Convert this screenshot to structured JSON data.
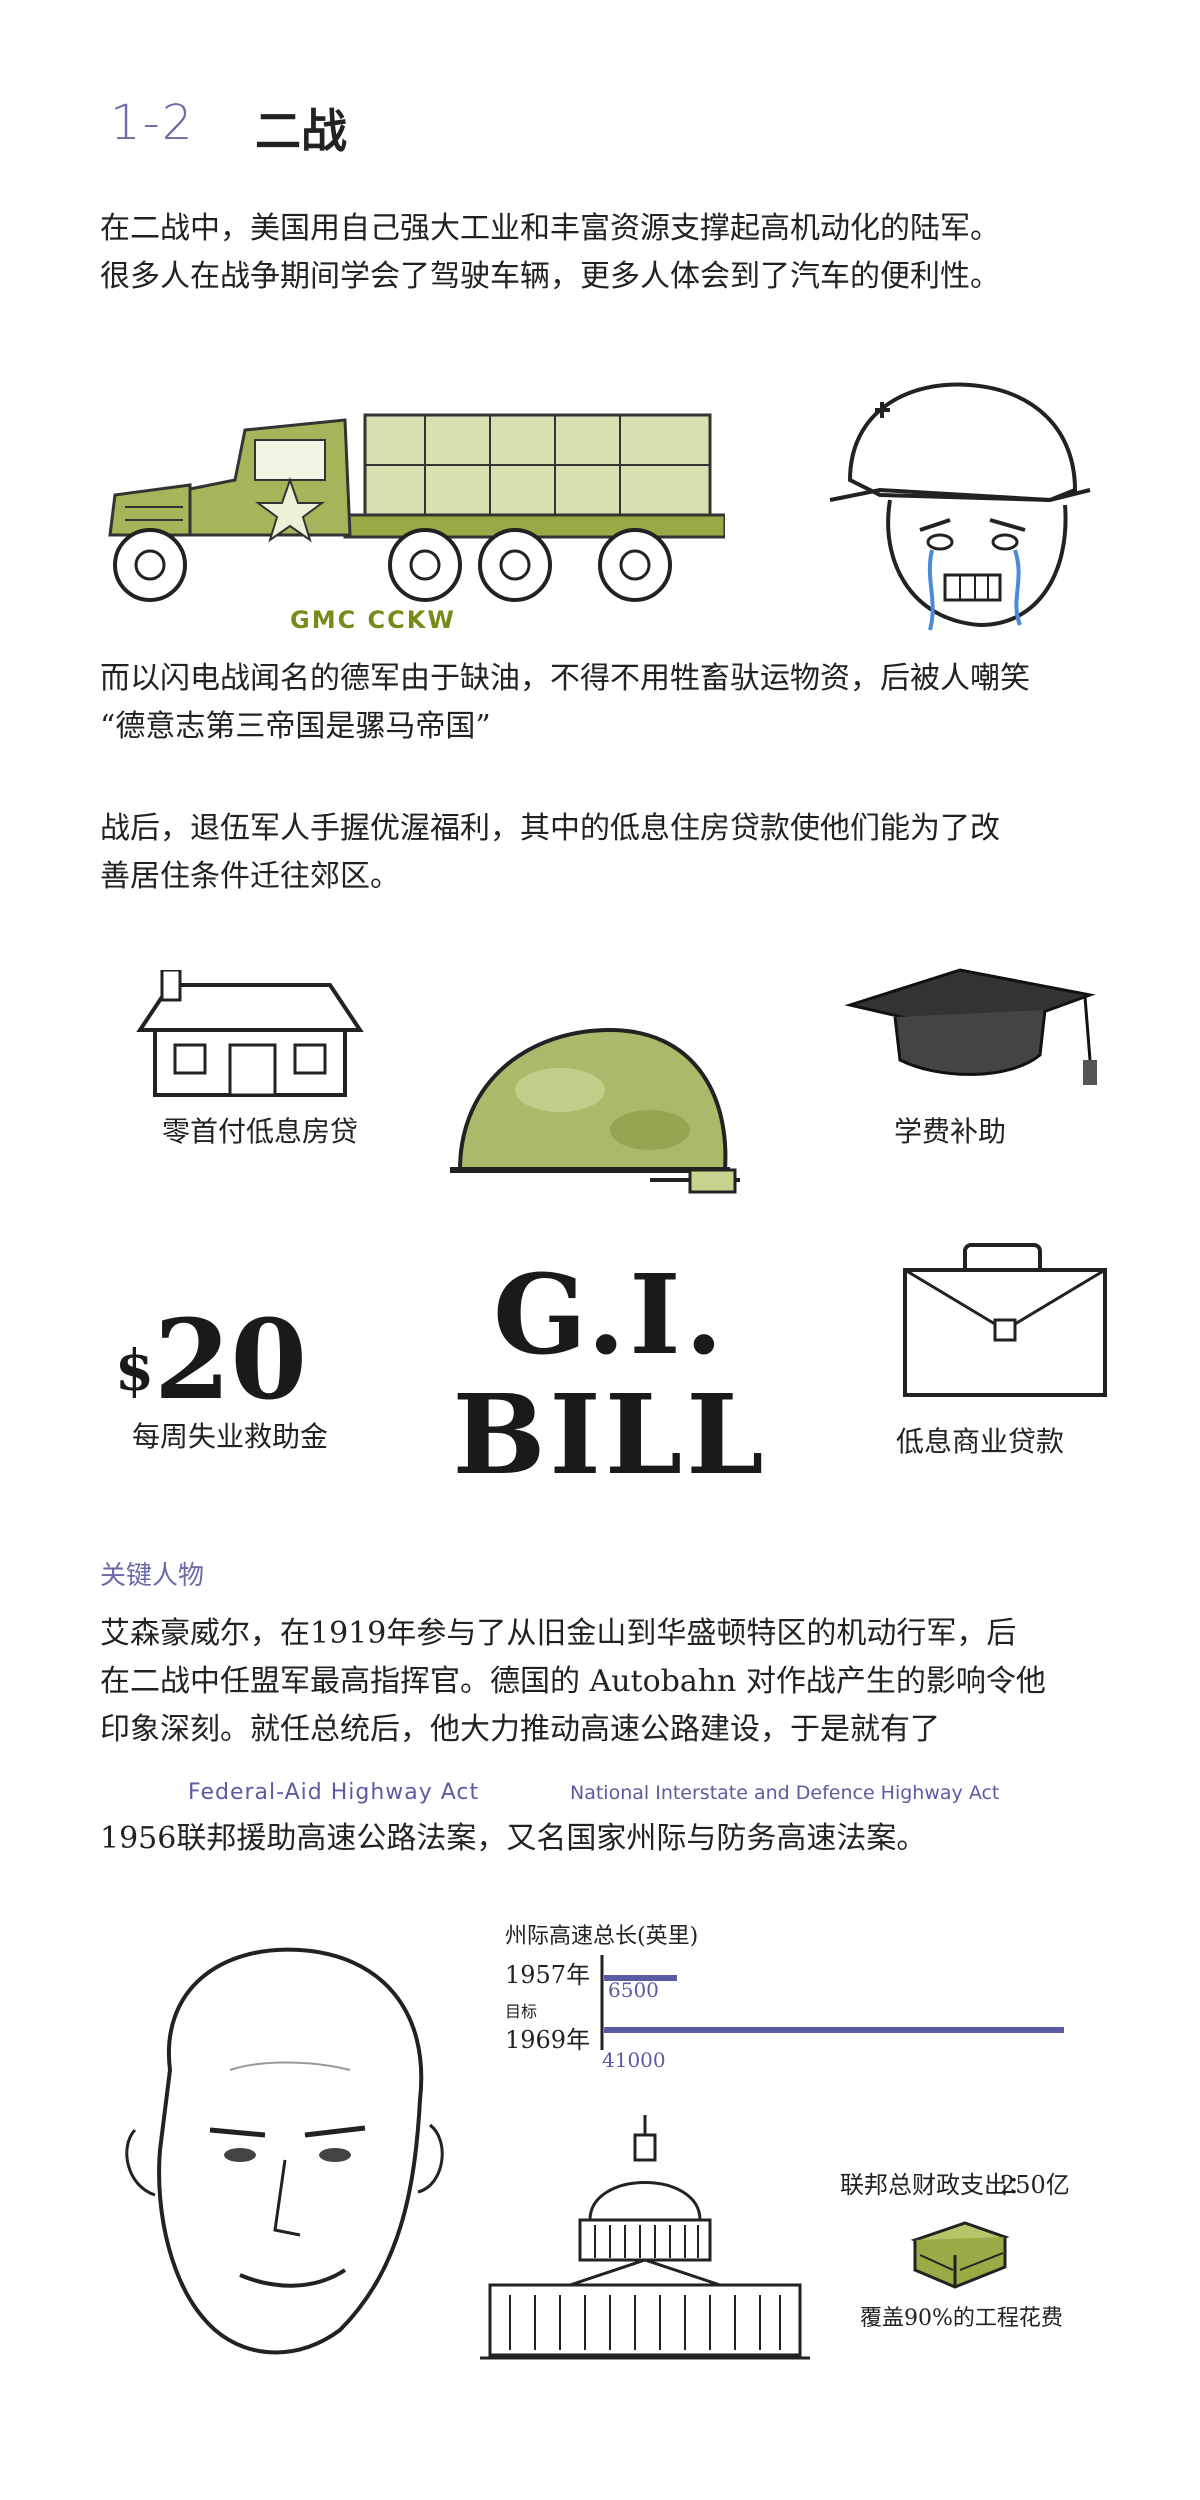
{
  "section": {
    "number": "1-2",
    "title": "二战"
  },
  "intro": {
    "line1": "在二战中，美国用自己强大工业和丰富资源支撑起高机动化的陆军。",
    "line2": "很多人在战争期间学会了驾驶车辆，更多人体会到了汽车的便利性。"
  },
  "truck_caption": "GMC CCKW",
  "blitz": {
    "line1": "而以闪电战闻名的德军由于缺油，不得不用牲畜驮运物资，后被人嘲笑",
    "line2": "“德意志第三帝国是骡马帝国”"
  },
  "postwar": {
    "line1": "战后，退伍军人手握优渥福利，其中的低息住房贷款使他们能为了改",
    "line2": "善居住条件迁往郊区。"
  },
  "benefits": {
    "house": "零首付低息房贷",
    "tuition": "学费补助",
    "unemployment": "每周失业救助金",
    "business_loan": "低息商业贷款",
    "dollar_sign": "$",
    "dollar_amount": "20",
    "gi_line1": "G.I.",
    "gi_line2": "BILL"
  },
  "key_figure_label": "关键人物",
  "ike": {
    "line1": "艾森豪威尔，在1919年参与了从旧金山到华盛顿特区的机动行军，后",
    "line2": "在二战中任盟军最高指挥官。德国的 Autobahn 对作战产生的影响令他",
    "line3": "印象深刻。就任总统后，他大力推动高速公路建设，于是就有了"
  },
  "act": {
    "en1": "Federal-Aid Highway Act",
    "en2": "National Interstate and Defence Highway Act",
    "line": "1956联邦援助高速公路法案，又名国家州际与防务高速法案。"
  },
  "chart_data": {
    "type": "bar",
    "title": "州际高速总长(英里)",
    "categories": [
      "1957年",
      "1969年"
    ],
    "category_notes": [
      "",
      "目标"
    ],
    "values": [
      6500,
      41000
    ],
    "value_labels": [
      "6500",
      "41000"
    ],
    "bar_color": "#5b5ba3"
  },
  "spending": {
    "label": "联邦总财政支出：",
    "value": "250亿",
    "coverage": "覆盖90%的工程花费"
  },
  "colors": {
    "accent": "#6a6aa8",
    "olive": "#7a8a1a",
    "bar": "#5b5ba3"
  }
}
